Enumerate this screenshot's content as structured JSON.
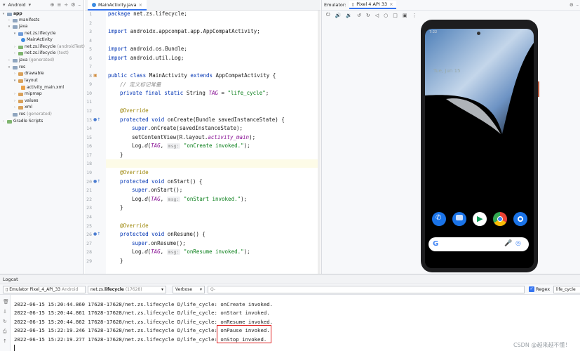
{
  "project_panel": {
    "title": "Android",
    "tree": [
      {
        "label": "app",
        "suffix": ""
      },
      {
        "label": "manifests",
        "suffix": ""
      },
      {
        "label": "java",
        "suffix": ""
      },
      {
        "label": "net.zs.lifecycle",
        "suffix": ""
      },
      {
        "label": "MainActivity",
        "suffix": ""
      },
      {
        "label": "net.zs.lifecycle",
        "suffix": "(androidTest)"
      },
      {
        "label": "net.zs.lifecycle",
        "suffix": "(test)"
      },
      {
        "label": "java",
        "suffix": "(generated)"
      },
      {
        "label": "res",
        "suffix": ""
      },
      {
        "label": "drawable",
        "suffix": ""
      },
      {
        "label": "layout",
        "suffix": ""
      },
      {
        "label": "activity_main.xml",
        "suffix": ""
      },
      {
        "label": "mipmap",
        "suffix": ""
      },
      {
        "label": "values",
        "suffix": ""
      },
      {
        "label": "xml",
        "suffix": ""
      },
      {
        "label": "res",
        "suffix": "(generated)"
      },
      {
        "label": "Gradle Scripts",
        "suffix": ""
      }
    ]
  },
  "editor": {
    "tab_label": "MainActivity.java",
    "line_numbers": [
      "1",
      "2",
      "3",
      "4",
      "5",
      "6",
      "7",
      "8",
      "9",
      "10",
      "11",
      "12",
      "13",
      "14",
      "15",
      "16",
      "17",
      "18",
      "19",
      "20",
      "21",
      "22",
      "23",
      "24",
      "25",
      "26",
      "27",
      "28",
      "29"
    ],
    "code": {
      "l1_kw": "package",
      "l1_rest": " net.zs.lifecycle;",
      "l3_kw": "import",
      "l3_rest": " androidx.appcompat.app.AppCompatActivity;",
      "l5_kw": "import",
      "l5_rest": " android.os.Bundle;",
      "l6_kw": "import",
      "l6_rest": " android.util.Log;",
      "l8_kw1": "public class",
      "l8_mid": " MainActivity ",
      "l8_kw2": "extends",
      "l8_rest": " AppCompatActivity {",
      "l9_comment": "// 定义标记常量",
      "l10_kw": "private final static",
      "l10_type": " String ",
      "l10_field": "TAG",
      "l10_eq": " = ",
      "l10_str": "\"life_cycle\"",
      "l10_end": ";",
      "l12_ann": "@Override",
      "l13_kw": "protected void",
      "l13_rest": " onCreate(Bundle savedInstanceState) {",
      "l14_kw": "super",
      "l14_rest": ".onCreate(savedInstanceState);",
      "l15_a": "setContentView(R.layout.",
      "l15_field": "activity_main",
      "l15_b": ");",
      "l16_a": "Log.",
      "l16_fn": "d",
      "l16_b": "(",
      "l16_tag": "TAG",
      "l16_c": ", ",
      "l16_hint": "msg:",
      "l16_str": " \"onCreate invoked.\"",
      "l16_d": ");",
      "l17": "}",
      "l19_ann": "@Override",
      "l20_kw": "protected void",
      "l20_rest": " onStart() {",
      "l21_kw": "super",
      "l21_rest": ".onStart();",
      "l22_a": "Log.",
      "l22_fn": "d",
      "l22_b": "(",
      "l22_tag": "TAG",
      "l22_c": ", ",
      "l22_hint": "msg:",
      "l22_str": " \"onStart invoked.\"",
      "l22_d": ");",
      "l23": "}",
      "l25_ann": "@Override",
      "l26_kw": "protected void",
      "l26_rest": " onResume() {",
      "l27_kw": "super",
      "l27_rest": ".onResume();",
      "l28_a": "Log.",
      "l28_fn": "d",
      "l28_b": "(",
      "l28_tag": "TAG",
      "l28_c": ", ",
      "l28_hint": "msg:",
      "l28_str": " \"onResume invoked.\"",
      "l28_d": ");",
      "l29": "}"
    }
  },
  "emulator": {
    "label": "Emulator:",
    "device_tab": "Pixel 4 API 33",
    "status_time": "7:22",
    "home_text": "Tue, Jun 15"
  },
  "logcat": {
    "title": "Logcat",
    "device_select": "Emulator Pixel_4_API_33",
    "device_select_suffix": "Android",
    "process_select": "net.zs.",
    "process_select_bold": "lifecycle",
    "process_select_pid": "(17628)",
    "level_select": "Verbose",
    "search_placeholder": "Q-",
    "regex_label": "Regex",
    "filter_value": "life_cycle",
    "lines": [
      {
        "prefix": "2022-06-15 15:20:44.860 17628-17628/net.zs.lifecycle D/life_cycle: ",
        "msg": "onCreate invoked."
      },
      {
        "prefix": "2022-06-15 15:20:44.861 17628-17628/net.zs.lifecycle D/life_cycle: ",
        "msg": "onStart invoked."
      },
      {
        "prefix": "2022-06-15 15:20:44.862 17628-17628/net.zs.lifecycle D/life_cycle: ",
        "msg": "onResume invoked."
      },
      {
        "prefix": "2022-06-15 15:22:19.246 17628-17628/net.zs.lifecycle D/life_cycle: ",
        "msg": "onPause invoked."
      },
      {
        "prefix": "2022-06-15 15:22:19.277 17628-17628/net.zs.lifecycle D/life_cycle: ",
        "msg": "onStop invoked."
      }
    ]
  },
  "watermark": "CSDN @越来越不懂！",
  "colors": {
    "accent": "#3574f0",
    "highlight_box": "#e02020",
    "keyword": "#0033b3",
    "string": "#067d17"
  }
}
